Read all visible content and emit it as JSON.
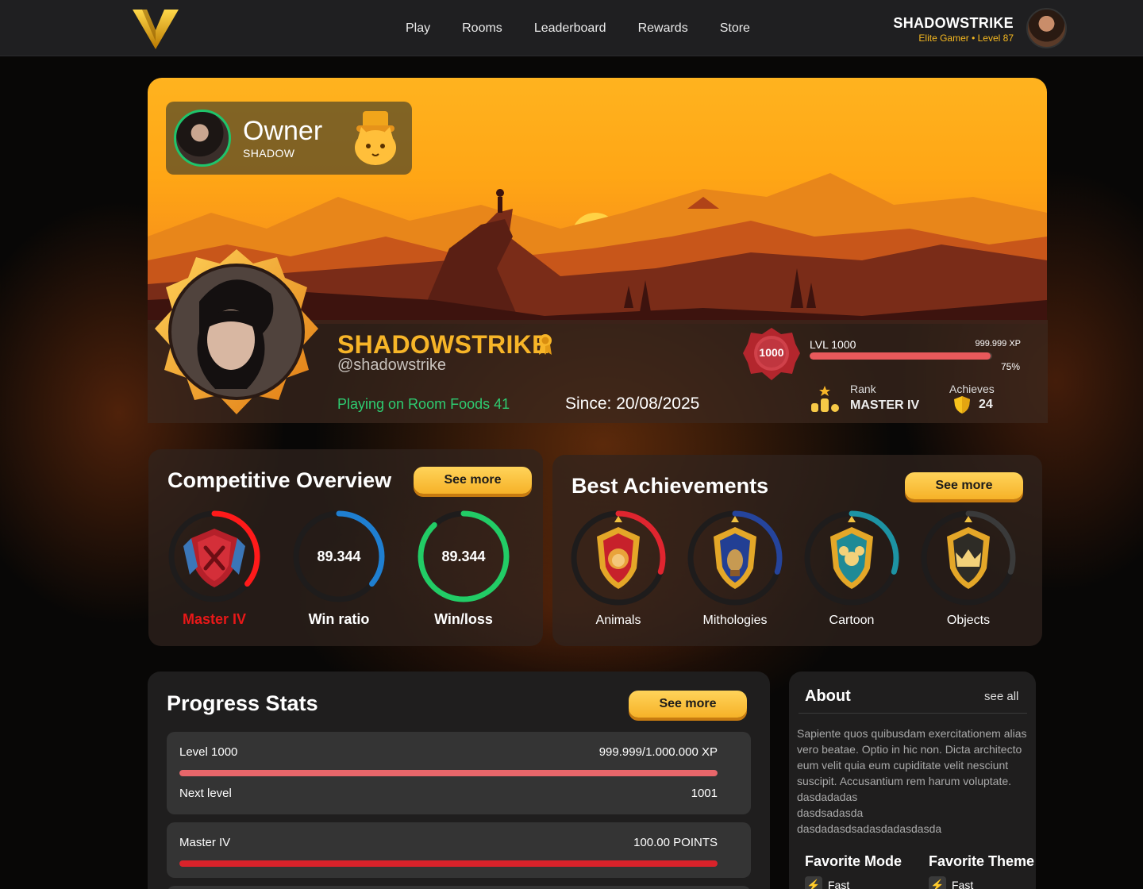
{
  "nav": {
    "items": [
      "Play",
      "Rooms",
      "Leaderboard",
      "Rewards",
      "Store"
    ]
  },
  "user": {
    "name": "SHADOWSTRIKE",
    "subtitle": "Elite Gamer • Level 87"
  },
  "owner": {
    "title": "Owner",
    "name": "SHADOW"
  },
  "profile": {
    "name": "SHADOWSTRIKE",
    "handle": "@shadowstrike",
    "playing": "Playing on Room Foods 41",
    "since": "Since: 20/08/2025",
    "level_badge": "1000",
    "level_label": "LVL 1000",
    "xp": "999.999 XP",
    "xp_percent": "75%",
    "xp_fraction": 0.99,
    "rank_label": "Rank",
    "rank_value": "MASTER IV",
    "achieves_label": "Achieves",
    "achieves_value": "24"
  },
  "competitive": {
    "title": "Competitive Overview",
    "see_more": "See more",
    "rings": [
      {
        "label": "Master IV",
        "value": "",
        "color": "#ff1a1a",
        "fraction": 0.36,
        "label_color": "#e81818"
      },
      {
        "label": "Win ratio",
        "value": "89.344",
        "color": "#1f7fd1",
        "fraction": 0.36,
        "label_color": "#ffffff"
      },
      {
        "label": "Win/loss",
        "value": "89.344",
        "color": "#22cc66",
        "fraction": 0.88,
        "label_color": "#ffffff"
      }
    ]
  },
  "achievements": {
    "title": "Best Achievements",
    "see_more": "See more",
    "items": [
      {
        "label": "Animals",
        "color": "#e0252f",
        "fraction": 0.3
      },
      {
        "label": "Mithologies",
        "color": "#25449c",
        "fraction": 0.3
      },
      {
        "label": "Cartoon",
        "color": "#1d93a4",
        "fraction": 0.3
      },
      {
        "label": "Objects",
        "color": "#3a3a3a",
        "fraction": 0.3
      }
    ]
  },
  "progress": {
    "title": "Progress Stats",
    "see_more": "See more",
    "rows": [
      {
        "left": "Level 1000",
        "right": "999.999/1.000.000 XP",
        "fraction": 1.0,
        "color": "#e8666a",
        "sub_left": "Next level",
        "sub_right": "1001"
      },
      {
        "left": "Master IV",
        "right": "100.00 POINTS",
        "fraction": 1.0,
        "color": "#d9222a"
      }
    ]
  },
  "about": {
    "title": "About",
    "link": "see all",
    "text": "Sapiente quos quibusdam exercitationem alias vero beatae. Optio in hic non. Dicta architecto eum velit quia eum cupiditate velit nesciunt suscipit. Accusantium rem harum voluptate.\ndasdadadas\ndasdsadasda\ndasdadasdsadasdadasdasda",
    "fav_mode_label": "Favorite Mode",
    "fav_mode_value": "Fast",
    "fav_theme_label": "Favorite Theme",
    "fav_theme_value": "Fast"
  },
  "colors": {
    "gold": "#f7b528",
    "accent_green": "#2ecc71",
    "xp_bar": "#e8595b"
  }
}
